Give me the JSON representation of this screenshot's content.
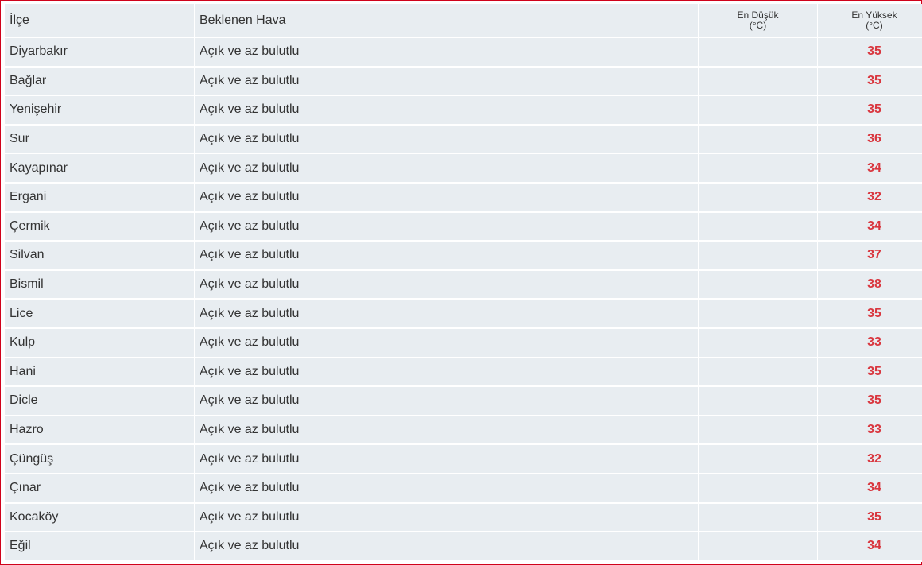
{
  "table": {
    "headers": {
      "district": "İlçe",
      "weather": "Beklenen Hava",
      "min_line1": "En Düşük",
      "min_line2": "(°C)",
      "max_line1": "En Yüksek",
      "max_line2": "(°C)"
    },
    "rows": [
      {
        "district": "Diyarbakır",
        "weather": "Açık ve az bulutlu",
        "min": "",
        "max": "35"
      },
      {
        "district": "Bağlar",
        "weather": "Açık ve az bulutlu",
        "min": "",
        "max": "35"
      },
      {
        "district": "Yenişehir",
        "weather": "Açık ve az bulutlu",
        "min": "",
        "max": "35"
      },
      {
        "district": "Sur",
        "weather": "Açık ve az bulutlu",
        "min": "",
        "max": "36"
      },
      {
        "district": "Kayapınar",
        "weather": "Açık ve az bulutlu",
        "min": "",
        "max": "34"
      },
      {
        "district": "Ergani",
        "weather": "Açık ve az bulutlu",
        "min": "",
        "max": "32"
      },
      {
        "district": "Çermik",
        "weather": "Açık ve az bulutlu",
        "min": "",
        "max": "34"
      },
      {
        "district": "Silvan",
        "weather": "Açık ve az bulutlu",
        "min": "",
        "max": "37"
      },
      {
        "district": "Bismil",
        "weather": "Açık ve az bulutlu",
        "min": "",
        "max": "38"
      },
      {
        "district": "Lice",
        "weather": "Açık ve az bulutlu",
        "min": "",
        "max": "35"
      },
      {
        "district": "Kulp",
        "weather": "Açık ve az bulutlu",
        "min": "",
        "max": "33"
      },
      {
        "district": "Hani",
        "weather": "Açık ve az bulutlu",
        "min": "",
        "max": "35"
      },
      {
        "district": "Dicle",
        "weather": "Açık ve az bulutlu",
        "min": "",
        "max": "35"
      },
      {
        "district": "Hazro",
        "weather": "Açık ve az bulutlu",
        "min": "",
        "max": "33"
      },
      {
        "district": "Çüngüş",
        "weather": "Açık ve az bulutlu",
        "min": "",
        "max": "32"
      },
      {
        "district": "Çınar",
        "weather": "Açık ve az bulutlu",
        "min": "",
        "max": "34"
      },
      {
        "district": "Kocaköy",
        "weather": "Açık ve az bulutlu",
        "min": "",
        "max": "35"
      },
      {
        "district": "Eğil",
        "weather": "Açık ve az bulutlu",
        "min": "",
        "max": "34"
      }
    ]
  },
  "colors": {
    "frame_border": "#d0021b",
    "cell_background": "#e8edf1",
    "max_temperature_text": "#d9363e"
  }
}
